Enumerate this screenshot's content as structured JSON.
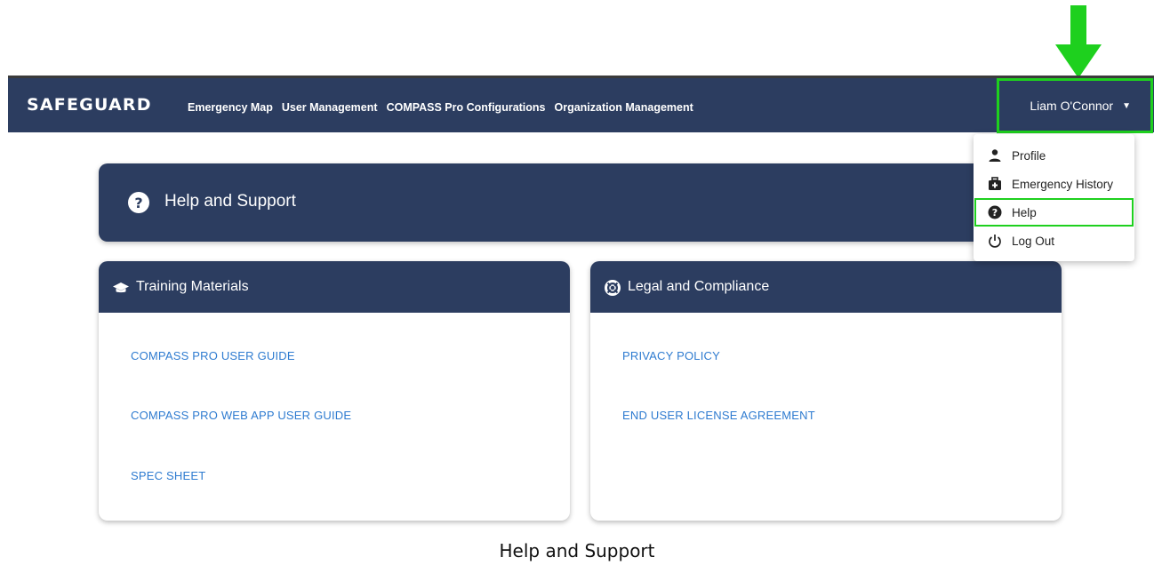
{
  "header": {
    "brand": "SAFEGUARD",
    "nav": [
      "Emergency Map",
      "User Management",
      "COMPASS Pro Configurations",
      "Organization Management"
    ],
    "user_name": "Liam O'Connor",
    "caret": "▼"
  },
  "dropdown": {
    "items": [
      {
        "label": "Profile",
        "icon": "person-icon"
      },
      {
        "label": "Emergency History",
        "icon": "medical-bag-icon"
      },
      {
        "label": "Help",
        "icon": "question-circle-icon"
      },
      {
        "label": "Log Out",
        "icon": "power-icon"
      }
    ]
  },
  "help_header": {
    "title": "Help and Support",
    "icon": "question-circle-icon"
  },
  "training": {
    "title": "Training Materials",
    "icon": "graduation-cap-icon",
    "links": [
      "COMPASS PRO USER GUIDE",
      "COMPASS PRO WEB APP USER GUIDE",
      "SPEC SHEET"
    ]
  },
  "legal": {
    "title": "Legal and Compliance",
    "icon": "life-ring-icon",
    "links": [
      "PRIVACY POLICY",
      "END USER LICENSE AGREEMENT"
    ]
  },
  "caption": "Help and Support",
  "colors": {
    "navy": "#2c3d60",
    "annotation_green": "#1ed01e",
    "link_blue": "#2e7bd0"
  }
}
